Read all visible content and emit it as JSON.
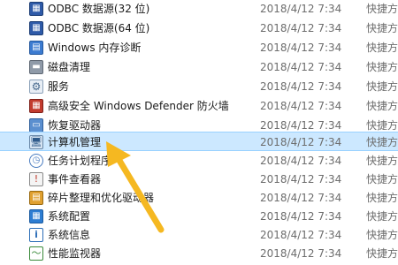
{
  "items": [
    {
      "name": "ODBC 数据源(32 位)",
      "date": "2018/4/12 7:34",
      "type": "快捷方",
      "icon": "odbc-icon"
    },
    {
      "name": "ODBC 数据源(64 位)",
      "date": "2018/4/12 7:34",
      "type": "快捷方",
      "icon": "odbc-icon"
    },
    {
      "name": "Windows 内存诊断",
      "date": "2018/4/12 7:34",
      "type": "快捷方",
      "icon": "memory-diagnostic-icon"
    },
    {
      "name": "磁盘清理",
      "date": "2018/4/12 7:34",
      "type": "快捷方",
      "icon": "disk-cleanup-icon"
    },
    {
      "name": "服务",
      "date": "2018/4/12 7:34",
      "type": "快捷方",
      "icon": "services-gear-icon"
    },
    {
      "name": "高级安全 Windows Defender 防火墙",
      "date": "2018/4/12 7:34",
      "type": "快捷方",
      "icon": "firewall-icon"
    },
    {
      "name": "恢复驱动器",
      "date": "2018/4/12 7:34",
      "type": "快捷方",
      "icon": "recovery-drive-icon"
    },
    {
      "name": "计算机管理",
      "date": "2018/4/12 7:34",
      "type": "快捷方",
      "icon": "computer-management-icon",
      "selected": true
    },
    {
      "name": "任务计划程序",
      "date": "2018/4/12 7:34",
      "type": "快捷方",
      "icon": "task-scheduler-clock-icon"
    },
    {
      "name": "事件查看器",
      "date": "2018/4/12 7:34",
      "type": "快捷方",
      "icon": "event-viewer-icon"
    },
    {
      "name": "碎片整理和优化驱动器",
      "date": "2018/4/12 7:34",
      "type": "快捷方",
      "icon": "defragment-icon"
    },
    {
      "name": "系统配置",
      "date": "2018/4/12 7:34",
      "type": "快捷方",
      "icon": "system-configuration-icon"
    },
    {
      "name": "系统信息",
      "date": "2018/4/12 7:34",
      "type": "快捷方",
      "icon": "system-information-icon"
    },
    {
      "name": "性能监视器",
      "date": "2018/4/12 7:34",
      "type": "快捷方",
      "icon": "performance-monitor-icon"
    }
  ],
  "colors": {
    "selection": "#cce8ff",
    "selection_border": "#99d1ff",
    "arrow": "#f5b821",
    "meta_text": "#6d6d6d"
  }
}
